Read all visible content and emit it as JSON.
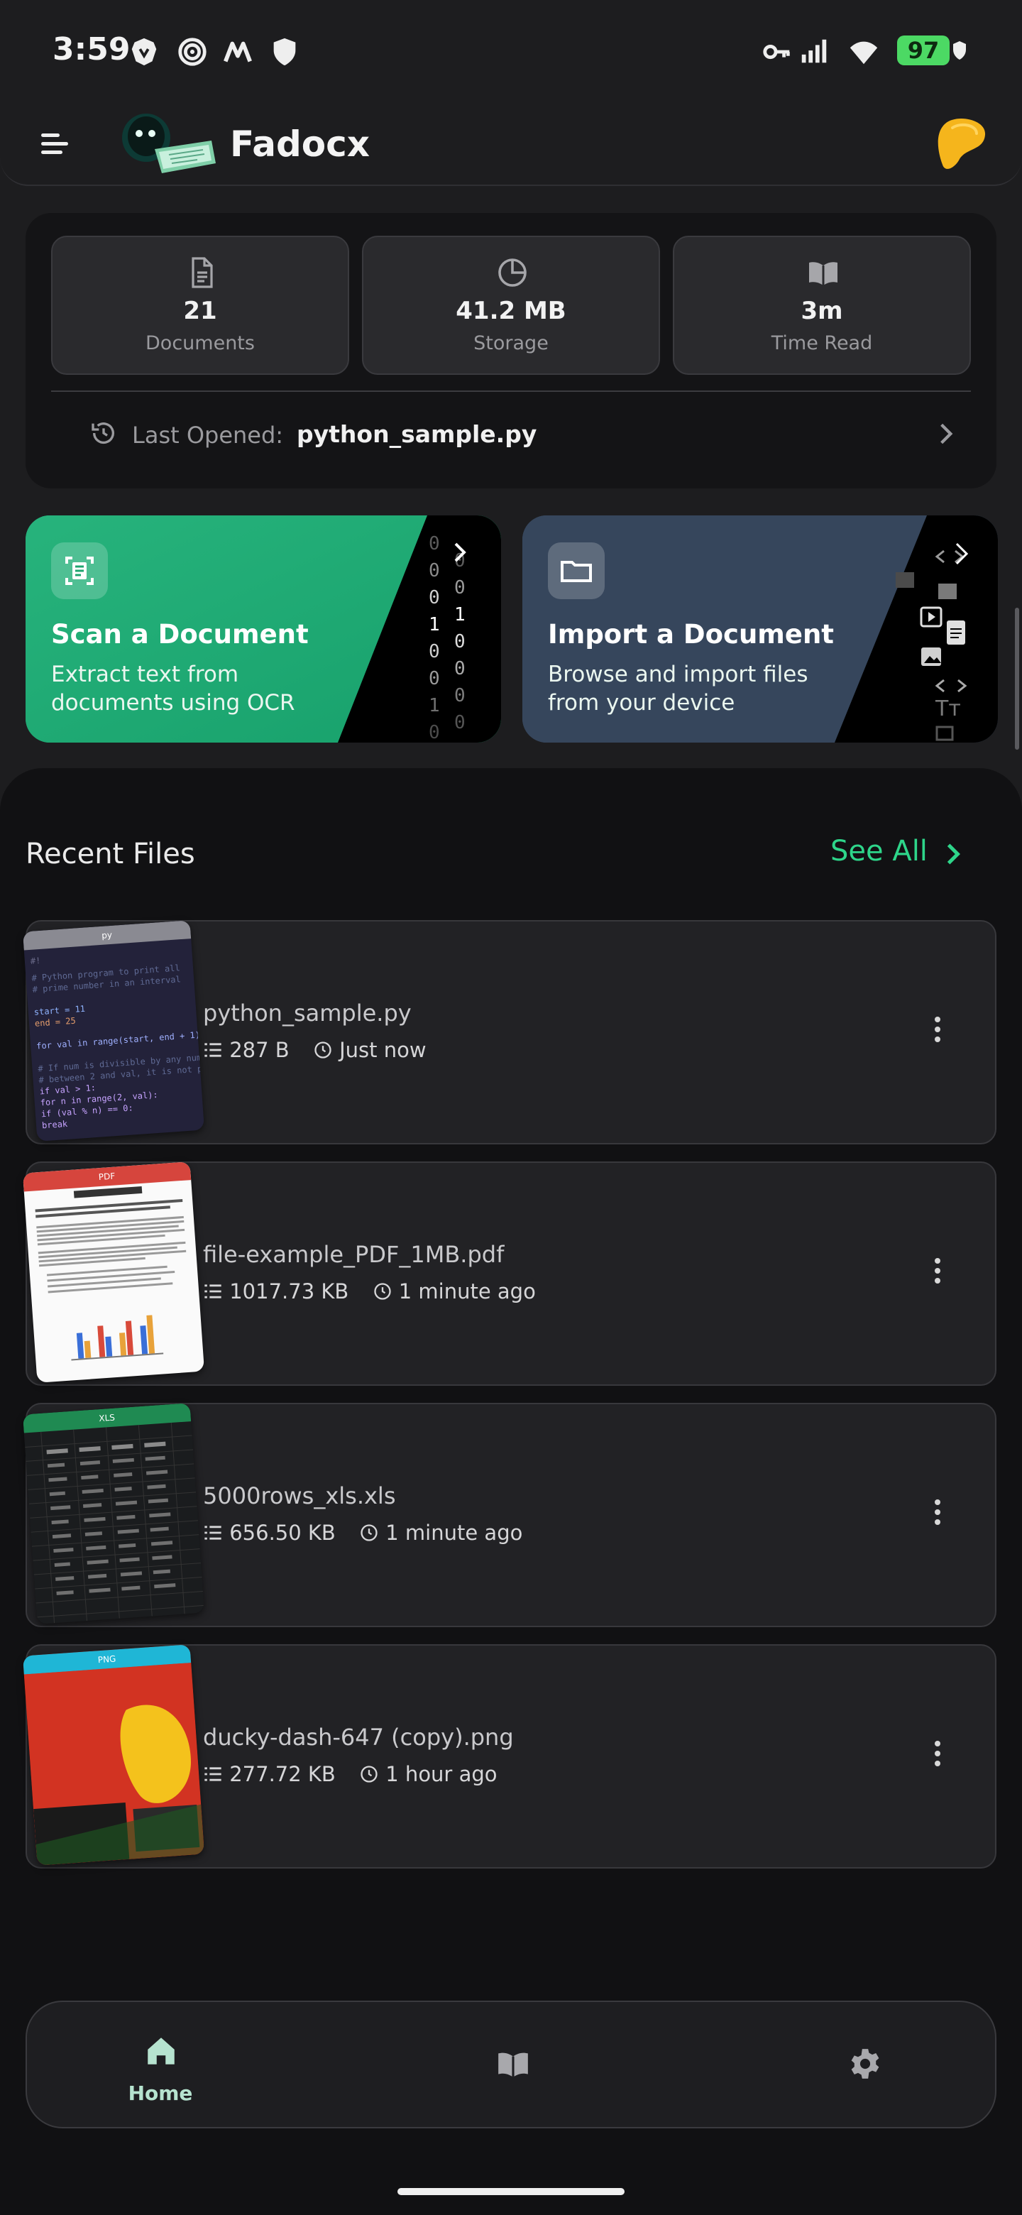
{
  "status_bar": {
    "time": "3:59",
    "battery": "97"
  },
  "app_bar": {
    "title": "Fadocx"
  },
  "stats": [
    {
      "icon": "document-icon",
      "value": "21",
      "label": "Documents"
    },
    {
      "icon": "pie-chart-icon",
      "value": "41.2 MB",
      "label": "Storage"
    },
    {
      "icon": "book-icon",
      "value": "3m",
      "label": "Time Read"
    }
  ],
  "last_opened": {
    "label": "Last Opened:",
    "file": "python_sample.py"
  },
  "actions": {
    "scan": {
      "title": "Scan a Document",
      "description": "Extract text from documents using OCR",
      "color": "#1fa46f"
    },
    "import": {
      "title": "Import a Document",
      "description": "Browse and import files from your device",
      "color": "#3a4a60"
    }
  },
  "recent": {
    "title": "Recent Files",
    "see_all": "See All",
    "files": [
      {
        "name": "python_sample.py",
        "size": "287 B",
        "time": "Just now",
        "type": "py"
      },
      {
        "name": "file-example_PDF_1MB.pdf",
        "size": "1017.73 KB",
        "time": "1 minute ago",
        "type": "pdf"
      },
      {
        "name": "5000rows_xls.xls",
        "size": "656.50 KB",
        "time": "1 minute ago",
        "type": "xls"
      },
      {
        "name": "ducky-dash-647 (copy).png",
        "size": "277.72 KB",
        "time": "1 hour ago",
        "type": "png"
      }
    ]
  },
  "nav": {
    "home_label": "Home"
  },
  "colors": {
    "accent": "#2ed58a",
    "background": "#1d1d1f",
    "sheet": "#111113"
  }
}
